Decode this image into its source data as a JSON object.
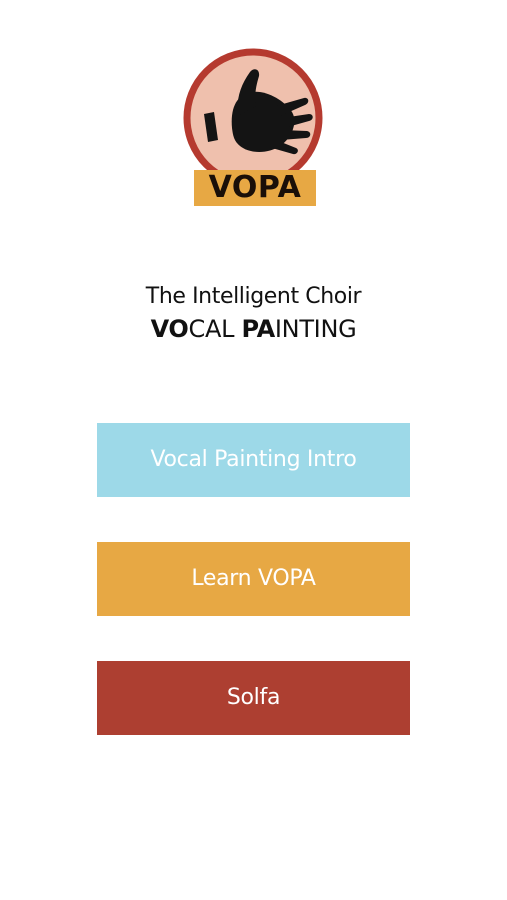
{
  "logo": {
    "text": "VOPA",
    "icon": "hand-icon",
    "circle_fill": "#efc0ad",
    "circle_stroke": "#b53a2f",
    "badge_color": "#e7a844"
  },
  "tagline": {
    "line1": "The Intelligent Choir",
    "line2_parts": [
      "VO",
      "CAL ",
      "PA",
      "INTING"
    ]
  },
  "menu": [
    {
      "label": "Vocal Painting Intro",
      "color": "#9dd9e8"
    },
    {
      "label": "Learn VOPA",
      "color": "#e7a844"
    },
    {
      "label": "Solfa",
      "color": "#ad3f31"
    }
  ]
}
